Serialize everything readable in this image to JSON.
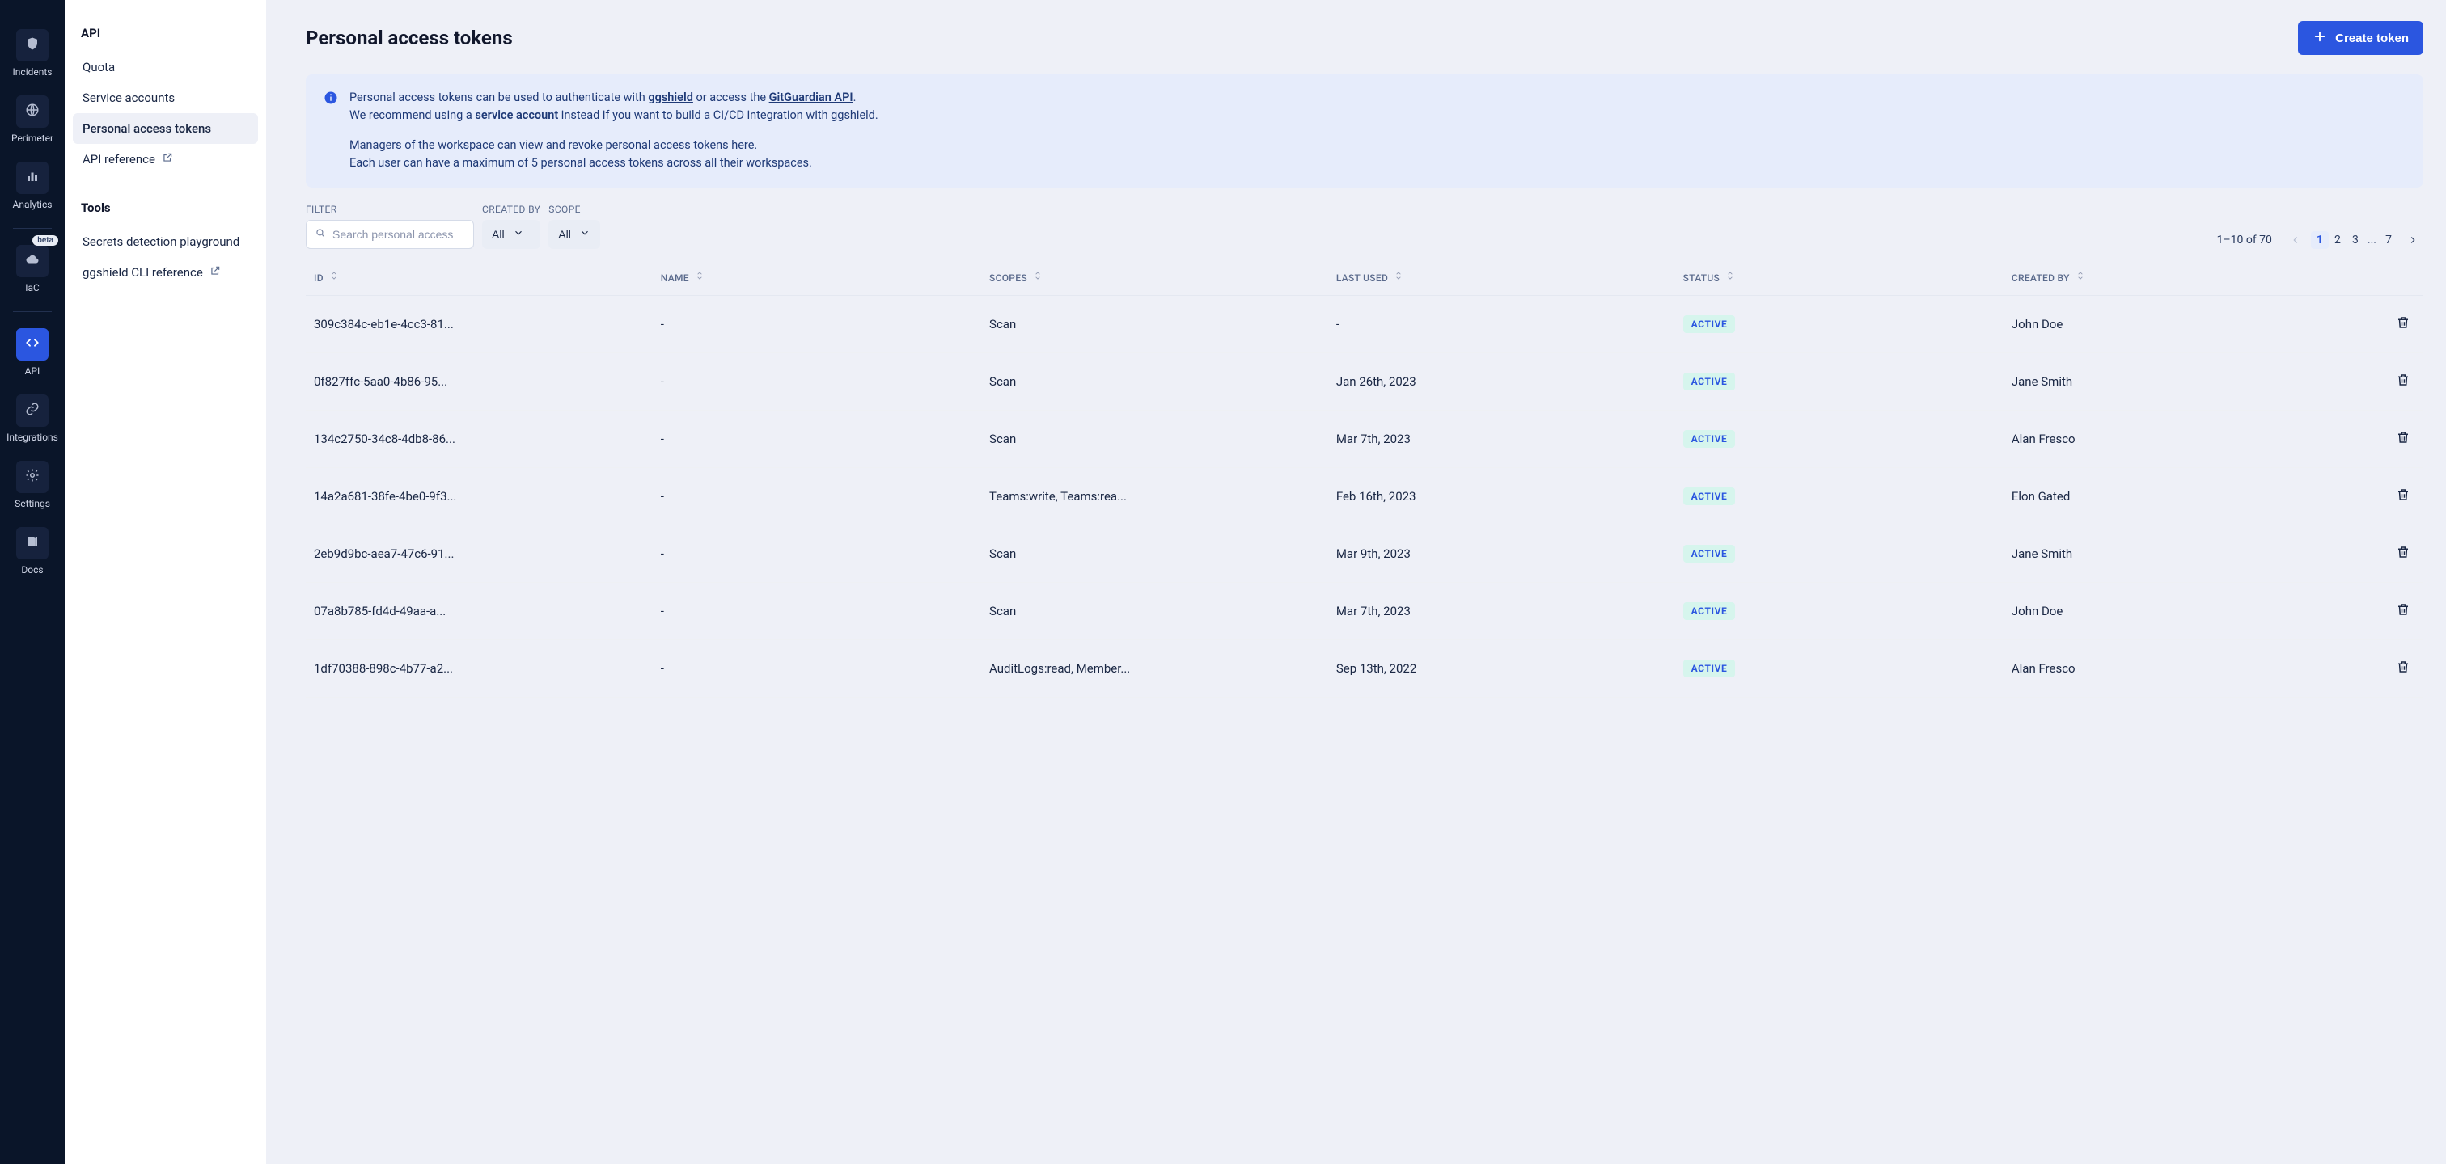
{
  "rail": {
    "items": [
      {
        "key": "incidents",
        "label": "Incidents",
        "icon": "shield-icon"
      },
      {
        "key": "perimeter",
        "label": "Perimeter",
        "icon": "globe-icon"
      },
      {
        "key": "analytics",
        "label": "Analytics",
        "icon": "bar-chart-icon"
      },
      {
        "key": "iac",
        "label": "IaC",
        "icon": "cloud-icon",
        "badge": "beta"
      },
      {
        "key": "api",
        "label": "API",
        "icon": "code-icon",
        "active": true
      },
      {
        "key": "integrations",
        "label": "Integrations",
        "icon": "link-icon"
      },
      {
        "key": "settings",
        "label": "Settings",
        "icon": "gear-icon"
      },
      {
        "key": "docs",
        "label": "Docs",
        "icon": "book-icon"
      }
    ]
  },
  "subnav": {
    "section_api": "API",
    "section_tools": "Tools",
    "items_api": [
      {
        "label": "Quota"
      },
      {
        "label": "Service accounts"
      },
      {
        "label": "Personal access tokens",
        "active": true
      },
      {
        "label": "API reference",
        "external": true
      }
    ],
    "items_tools": [
      {
        "label": "Secrets detection playground"
      },
      {
        "label": "ggshield CLI reference",
        "external": true
      }
    ]
  },
  "page": {
    "title": "Personal access tokens",
    "create_button": "Create token"
  },
  "banner": {
    "line1_pre": "Personal access tokens can be used to authenticate with ",
    "link1": "ggshield",
    "line1_mid": " or access the ",
    "link2": "GitGuardian API",
    "line1_post": ".",
    "line2_pre": "We recommend using a ",
    "link3": "service account",
    "line2_post": " instead if you want to build a CI/CD integration with ggshield.",
    "line3": "Managers of the workspace can view and revoke personal access tokens here.",
    "line4": "Each user can have a maximum of 5 personal access tokens across all their workspaces."
  },
  "filters": {
    "filter_label": "FILTER",
    "search_placeholder": "Search personal access",
    "created_by_label": "CREATED BY",
    "created_by_value": "All",
    "scope_label": "SCOPE",
    "scope_value": "All"
  },
  "pagination": {
    "range": "1–10 of 70",
    "pages": [
      "1",
      "2",
      "3",
      "...",
      "7"
    ],
    "current": "1"
  },
  "table": {
    "headers": {
      "id": "ID",
      "name": "NAME",
      "scopes": "SCOPES",
      "last_used": "LAST USED",
      "status": "STATUS",
      "created_by": "CREATED BY"
    },
    "rows": [
      {
        "id": "309c384c-eb1e-4cc3-81...",
        "name": "-",
        "scopes": "Scan",
        "last_used": "-",
        "status": "ACTIVE",
        "created_by": "John Doe"
      },
      {
        "id": "0f827ffc-5aa0-4b86-95...",
        "name": "-",
        "scopes": "Scan",
        "last_used": "Jan 26th, 2023",
        "status": "ACTIVE",
        "created_by": "Jane Smith"
      },
      {
        "id": "134c2750-34c8-4db8-86...",
        "name": "-",
        "scopes": "Scan",
        "last_used": "Mar 7th, 2023",
        "status": "ACTIVE",
        "created_by": "Alan Fresco"
      },
      {
        "id": "14a2a681-38fe-4be0-9f3...",
        "name": "-",
        "scopes": "Teams:write, Teams:rea...",
        "last_used": "Feb 16th, 2023",
        "status": "ACTIVE",
        "created_by": "Elon Gated"
      },
      {
        "id": "2eb9d9bc-aea7-47c6-91...",
        "name": "-",
        "scopes": "Scan",
        "last_used": "Mar 9th, 2023",
        "status": "ACTIVE",
        "created_by": "Jane Smith"
      },
      {
        "id": "07a8b785-fd4d-49aa-a...",
        "name": "-",
        "scopes": "Scan",
        "last_used": "Mar 7th, 2023",
        "status": "ACTIVE",
        "created_by": "John Doe"
      },
      {
        "id": "1df70388-898c-4b77-a2...",
        "name": "-",
        "scopes": "AuditLogs:read, Member...",
        "last_used": "Sep 13th, 2022",
        "status": "ACTIVE",
        "created_by": "Alan Fresco"
      }
    ]
  }
}
